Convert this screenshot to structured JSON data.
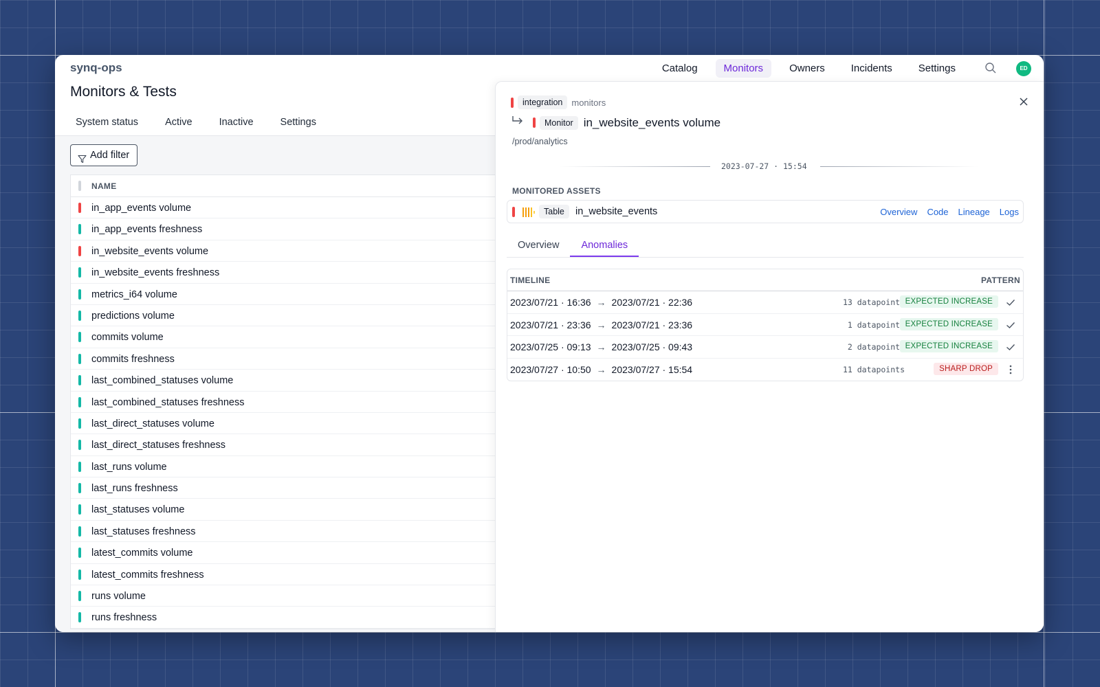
{
  "app": {
    "brand": "synq-ops"
  },
  "topnav": {
    "items": [
      "Catalog",
      "Monitors",
      "Owners",
      "Incidents",
      "Settings"
    ],
    "active": "Monitors",
    "avatar_initials": "ED"
  },
  "page": {
    "title": "Monitors & Tests"
  },
  "tabs": {
    "items": [
      "System status",
      "Active",
      "Inactive",
      "Settings"
    ],
    "active": "Active"
  },
  "filter": {
    "add_label": "Add filter"
  },
  "monitors_table": {
    "header": "NAME",
    "rows": [
      {
        "name": "in_app_events volume",
        "status": "error"
      },
      {
        "name": "in_app_events freshness",
        "status": "ok"
      },
      {
        "name": "in_website_events volume",
        "status": "error"
      },
      {
        "name": "in_website_events freshness",
        "status": "ok"
      },
      {
        "name": "metrics_i64 volume",
        "status": "ok"
      },
      {
        "name": "predictions volume",
        "status": "ok"
      },
      {
        "name": "commits volume",
        "status": "ok"
      },
      {
        "name": "commits freshness",
        "status": "ok"
      },
      {
        "name": "last_combined_statuses volume",
        "status": "ok"
      },
      {
        "name": "last_combined_statuses freshness",
        "status": "ok"
      },
      {
        "name": "last_direct_statuses volume",
        "status": "ok"
      },
      {
        "name": "last_direct_statuses freshness",
        "status": "ok"
      },
      {
        "name": "last_runs volume",
        "status": "ok"
      },
      {
        "name": "last_runs freshness",
        "status": "ok"
      },
      {
        "name": "last_statuses volume",
        "status": "ok"
      },
      {
        "name": "last_statuses freshness",
        "status": "ok"
      },
      {
        "name": "latest_commits volume",
        "status": "ok"
      },
      {
        "name": "latest_commits freshness",
        "status": "ok"
      },
      {
        "name": "runs volume",
        "status": "ok"
      },
      {
        "name": "runs freshness",
        "status": "ok"
      }
    ]
  },
  "panel": {
    "integration_chip": "integration",
    "integration_name": "monitors",
    "monitor_chip": "Monitor",
    "monitor_title": "in_website_events volume",
    "path": "/prod/analytics",
    "timestamp": "2023-07-27 · 15:54",
    "assets_label": "MONITORED ASSETS",
    "asset": {
      "type_chip": "Table",
      "name": "in_website_events",
      "links": [
        "Overview",
        "Code",
        "Lineage",
        "Logs"
      ]
    },
    "tabs": [
      "Overview",
      "Anomalies"
    ],
    "active_tab": "Anomalies",
    "anomalies": {
      "col_timeline": "TIMELINE",
      "col_pattern": "PATTERN",
      "rows": [
        {
          "start": "2023/07/21 · 16:36",
          "end": "2023/07/21 · 22:36",
          "datapoints": "13 datapoints",
          "pattern": "EXPECTED INCREASE",
          "kind": "ok",
          "action": "check-icon"
        },
        {
          "start": "2023/07/21 · 23:36",
          "end": "2023/07/21 · 23:36",
          "datapoints": "1 datapoints",
          "pattern": "EXPECTED INCREASE",
          "kind": "ok",
          "action": "check-icon"
        },
        {
          "start": "2023/07/25 · 09:13",
          "end": "2023/07/25 · 09:43",
          "datapoints": "2 datapoints",
          "pattern": "EXPECTED INCREASE",
          "kind": "ok",
          "action": "check-icon"
        },
        {
          "start": "2023/07/27 · 10:50",
          "end": "2023/07/27 · 15:54",
          "datapoints": "11 datapoints",
          "pattern": "SHARP DROP",
          "kind": "bad",
          "action": "more-vertical-icon"
        }
      ]
    }
  },
  "colors": {
    "status_error": "#ef4444",
    "status_ok": "#14b8a6",
    "accent": "#6d28d9",
    "link": "#1d63d6"
  }
}
